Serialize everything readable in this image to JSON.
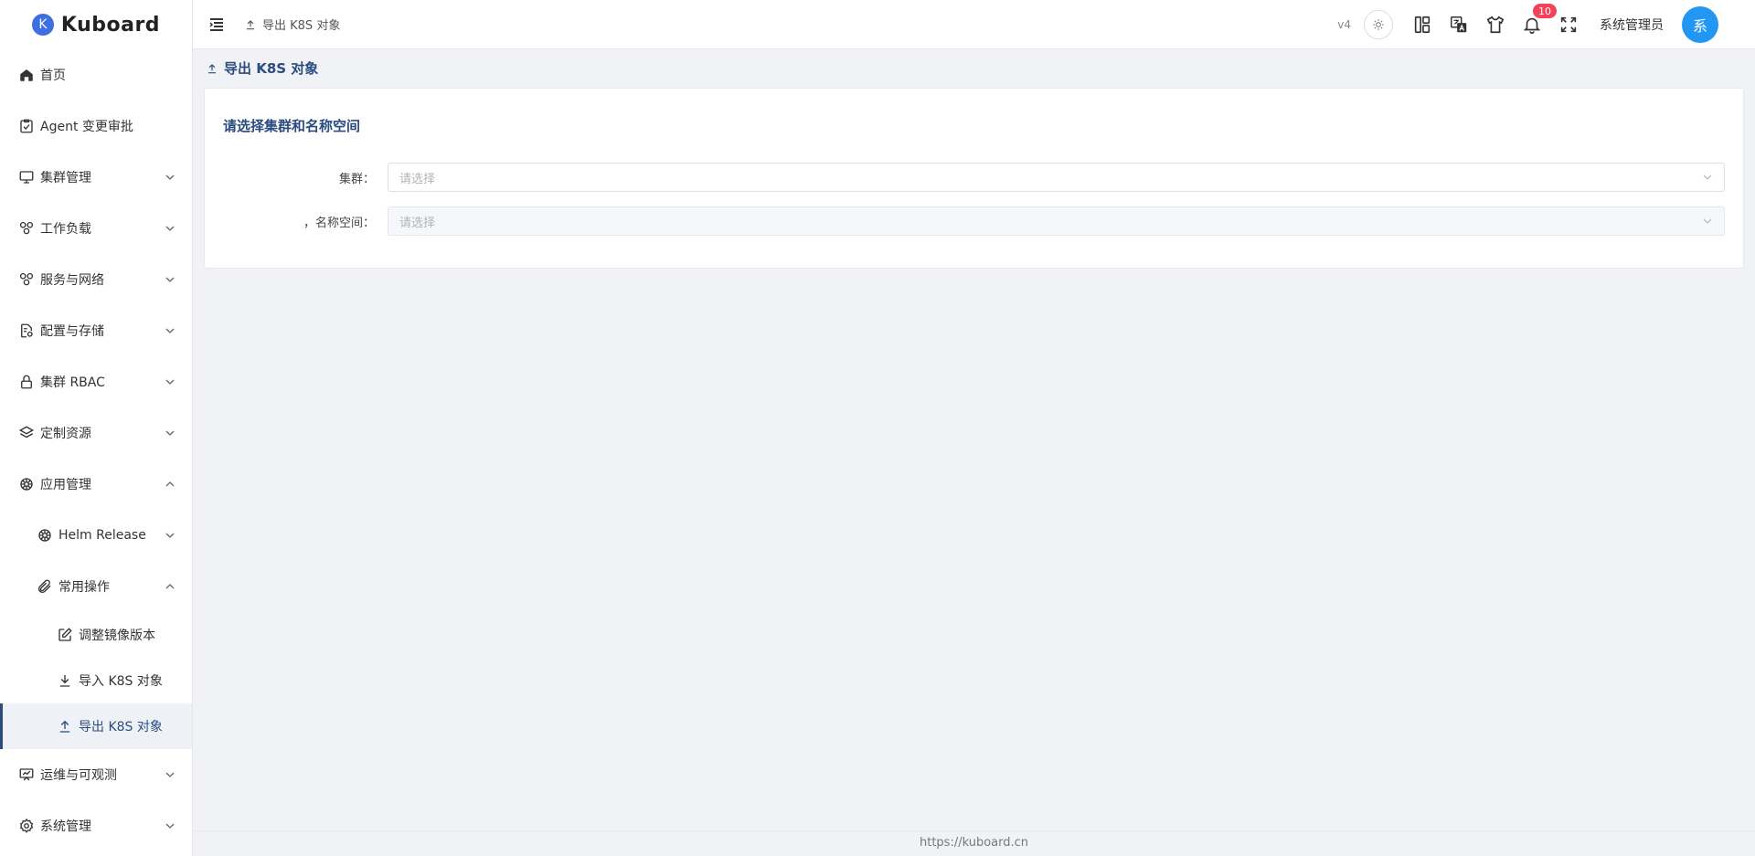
{
  "app": {
    "logo_letter": "K",
    "name": "Kuboard"
  },
  "sidebar": {
    "items": [
      {
        "label": "首页",
        "icon": "home-icon"
      },
      {
        "label": "Agent 变更审批",
        "icon": "approval-icon"
      },
      {
        "label": "集群管理",
        "icon": "monitor-icon"
      },
      {
        "label": "工作负载",
        "icon": "workload-icon"
      },
      {
        "label": "服务与网络",
        "icon": "network-icon"
      },
      {
        "label": "配置与存储",
        "icon": "config-icon"
      },
      {
        "label": "集群 RBAC",
        "icon": "lock-icon"
      },
      {
        "label": "定制资源",
        "icon": "layers-icon"
      },
      {
        "label": "应用管理",
        "icon": "helm-icon"
      },
      {
        "label": "Helm Release",
        "icon": "helm-icon"
      },
      {
        "label": "常用操作",
        "icon": "paperclip-icon"
      },
      {
        "label": "调整镜像版本",
        "icon": "edit-icon"
      },
      {
        "label": "导入 K8S 对象",
        "icon": "download-icon"
      },
      {
        "label": "导出 K8S 对象",
        "icon": "upload-icon"
      },
      {
        "label": "运维与可观测",
        "icon": "dashboard-icon"
      },
      {
        "label": "系统管理",
        "icon": "gear-icon"
      }
    ]
  },
  "header": {
    "breadcrumb": "导出 K8S 对象",
    "version": "v4",
    "notification_count": "10",
    "username": "系统管理员",
    "avatar_letter": "系"
  },
  "main": {
    "page_title": "导出 K8S 对象",
    "card_title": "请选择集群和名称空间",
    "cluster_label": "集群：",
    "cluster_placeholder": "请选择",
    "namespace_label": "，名称空间：",
    "namespace_placeholder": "请选择"
  },
  "footer": {
    "url": "https://kuboard.cn"
  },
  "colors": {
    "accent": "#2c4c80",
    "avatar": "#2196f3",
    "badge": "#f5425b"
  }
}
